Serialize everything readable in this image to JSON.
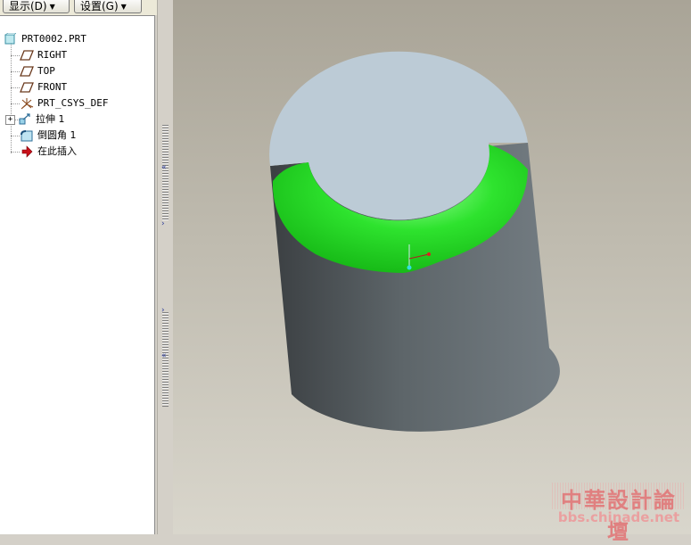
{
  "toolbar": {
    "display_label": "显示(D)",
    "settings_label": "设置(G)"
  },
  "model_tree": {
    "root": "PRT0002.PRT",
    "items": [
      {
        "label": "RIGHT",
        "icon": "datum-plane-icon"
      },
      {
        "label": "TOP",
        "icon": "datum-plane-icon"
      },
      {
        "label": "FRONT",
        "icon": "datum-plane-icon"
      },
      {
        "label": "PRT_CSYS_DEF",
        "icon": "coordinate-system-icon"
      },
      {
        "label": "拉伸 1",
        "icon": "extrude-icon"
      },
      {
        "label": "倒圆角 1",
        "icon": "round-icon"
      },
      {
        "label": "在此插入",
        "icon": "insert-here-arrow-icon"
      }
    ]
  },
  "viewport": {
    "highlight_color": "#2ee32e",
    "body_color": "#6e767c",
    "top_face_color": "#bccbd6"
  },
  "watermark": {
    "title": "中華設計論壇",
    "url": "bbs.chinade.net"
  }
}
